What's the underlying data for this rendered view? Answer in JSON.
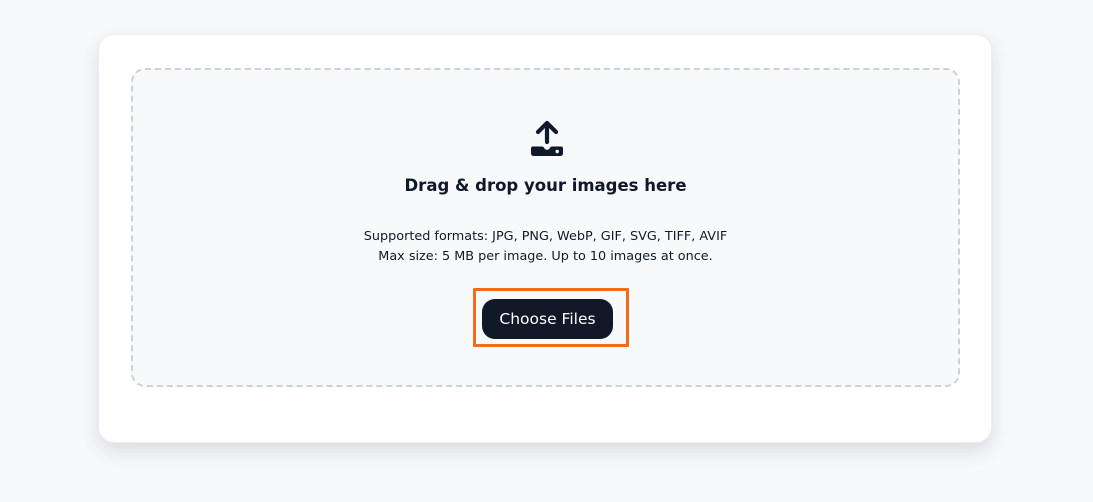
{
  "dropzone": {
    "icon": "upload-tray-icon",
    "heading": "Drag & drop your images here",
    "formats_text": "Supported formats: JPG, PNG, WebP, GIF, SVG, TIFF, AVIF",
    "limits_text": "Max size: 5 MB per image. Up to 10 images at once.",
    "button_label": "Choose Files"
  },
  "colors": {
    "page_background": "#f7f8fa",
    "card_background": "#ffffff",
    "dropzone_background": "#f8f9fb",
    "dropzone_border": "#cdd1d8",
    "button_background": "#111827",
    "button_text": "#ffffff",
    "highlight_outline": "#f26a1b"
  }
}
